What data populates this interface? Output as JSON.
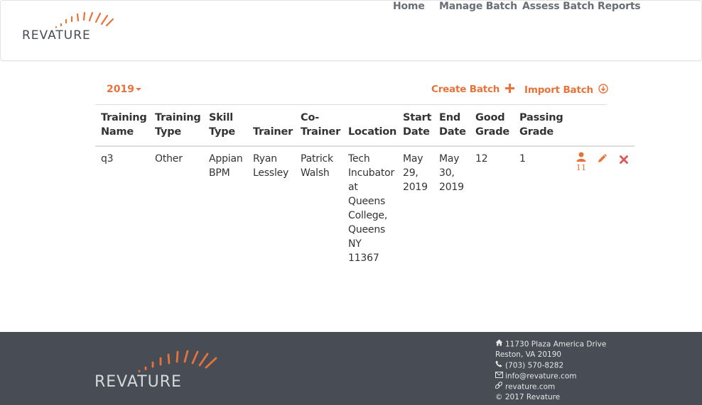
{
  "brand": {
    "name": "REVATURE"
  },
  "nav": {
    "home": "Home",
    "manage_batch": "Manage Batch",
    "assess_batch": "Assess Batch",
    "reports": "Reports"
  },
  "toolbar": {
    "year": "2019",
    "create_batch": "Create Batch",
    "import_batch": "Import Batch"
  },
  "table": {
    "headers": {
      "training_name": [
        "Training",
        "Name"
      ],
      "training_type": [
        "Training",
        "Type"
      ],
      "skill_type": [
        "Skill",
        "Type"
      ],
      "trainer": [
        "Trainer"
      ],
      "co_trainer": [
        "Co-",
        "Trainer"
      ],
      "location": [
        "Location"
      ],
      "start_date": [
        "Start",
        "Date"
      ],
      "end_date": [
        "End",
        "Date"
      ],
      "good_grade": [
        "Good",
        "Grade"
      ],
      "passing_grade": [
        "Passing",
        "Grade"
      ]
    },
    "rows": [
      {
        "training_name": "q3",
        "training_type": "Other",
        "skill_type": [
          "Appian",
          "BPM"
        ],
        "trainer": [
          "Ryan",
          "Lessley"
        ],
        "co_trainer": [
          "Patrick",
          "Walsh"
        ],
        "location": [
          "Tech",
          "Incubator",
          "at",
          "Queens",
          "College,",
          "Queens",
          "NY",
          "11367"
        ],
        "start_date": [
          "May",
          "29,",
          "2019"
        ],
        "end_date": [
          "May",
          "30,",
          "2019"
        ],
        "good_grade": "12",
        "passing_grade": "1",
        "trainee_count": "11"
      }
    ]
  },
  "footer": {
    "address1": "11730 Plaza America Drive",
    "address2": "Reston, VA 20190",
    "phone": "(703) 570-8282",
    "email": "info@revature.com",
    "website": "revature.com",
    "copyright": "© 2017 Revature"
  },
  "colors": {
    "accent": "#e8733a",
    "delete": "#e05555",
    "footer_bg": "#474c55",
    "logo_text": "#474c55"
  },
  "icons": [
    "home-icon",
    "phone-icon",
    "envelope-icon",
    "link-icon",
    "user-icon",
    "pencil-icon",
    "remove-icon",
    "plus-icon",
    "download-circle-icon",
    "caret-down-icon"
  ]
}
